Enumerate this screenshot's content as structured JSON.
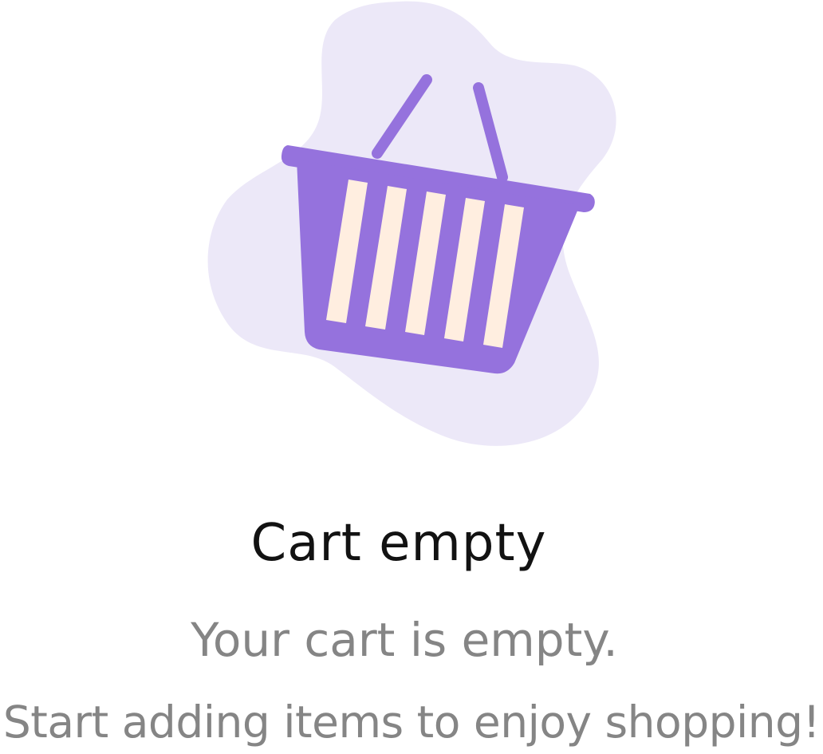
{
  "empty_state": {
    "illustration_icon": "shopping-basket-icon",
    "title": "Cart empty",
    "message_line1": "Your cart is empty.",
    "message_line2": "Start adding items to enjoy shopping!"
  },
  "colors": {
    "blob": "#ECE8F8",
    "basket": "#9572DD",
    "slats": "#FFEEE0",
    "title_text": "#121212",
    "message_text": "#858585",
    "background": "#FFFFFF"
  }
}
